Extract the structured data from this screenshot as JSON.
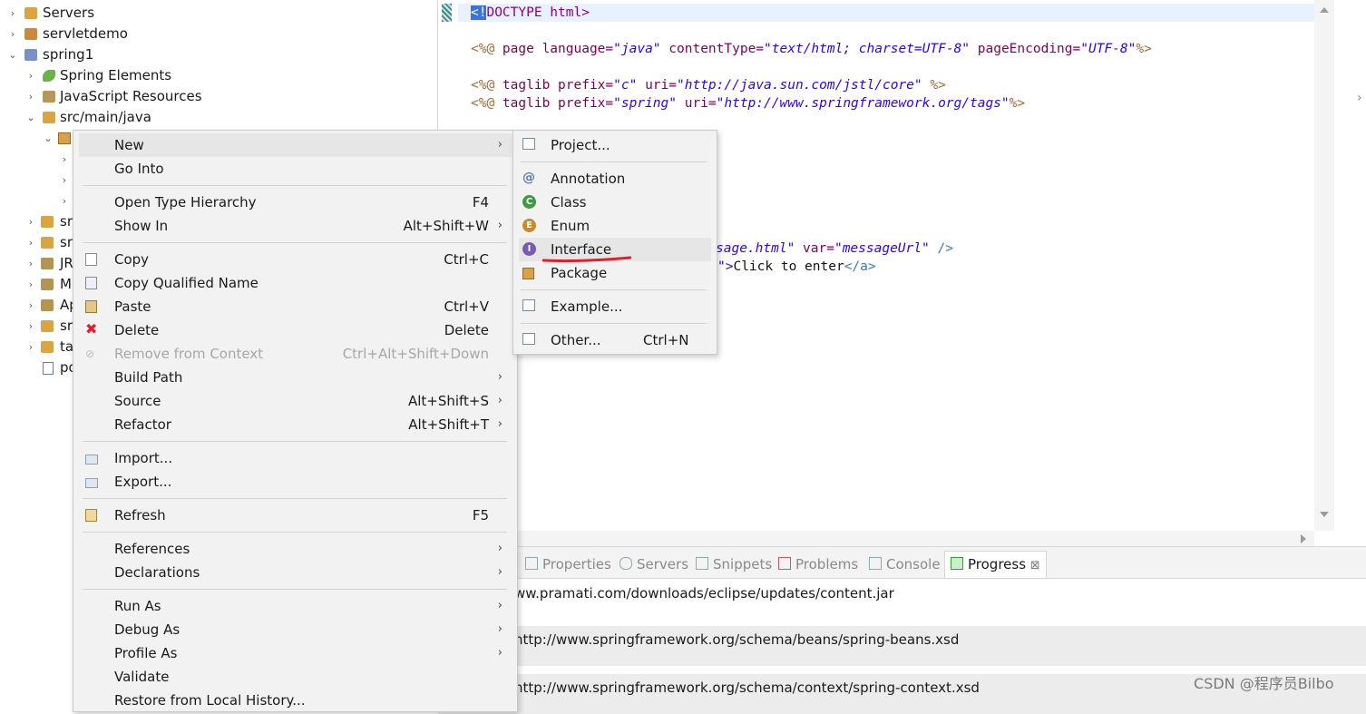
{
  "explorer": {
    "items": [
      {
        "label": "Servers",
        "twisty": "›"
      },
      {
        "label": "servletdemo",
        "twisty": "›"
      },
      {
        "label": "spring1",
        "twisty": "⌄"
      },
      {
        "label": "Spring Elements",
        "twisty": "›"
      },
      {
        "label": "JavaScript Resources",
        "twisty": "›"
      },
      {
        "label": "src/main/java",
        "twisty": "⌄"
      },
      {
        "label": "",
        "twisty": "⌄"
      },
      {
        "label": "",
        "twisty": "›"
      },
      {
        "label": "",
        "twisty": "›"
      },
      {
        "label": "",
        "twisty": "›"
      },
      {
        "label": "sr",
        "twisty": "›"
      },
      {
        "label": "sr",
        "twisty": "›"
      },
      {
        "label": "JR",
        "twisty": "›"
      },
      {
        "label": "M",
        "twisty": "›"
      },
      {
        "label": "Ap",
        "twisty": "›"
      },
      {
        "label": "sr",
        "twisty": "›"
      },
      {
        "label": "ta",
        "twisty": "›"
      },
      {
        "label": "po",
        "twisty": ""
      }
    ]
  },
  "editor": {
    "line1": {
      "lt": "<",
      "excl": "!",
      "rest": "DOCTYPE html>"
    },
    "line2": {
      "a": "<%@ ",
      "b": "page ",
      "c": "language=",
      "d": "\"java\"",
      "e": " contentType=",
      "f": "\"text/html; charset=UTF-8\"",
      "g": " pageEncoding=",
      "h": "\"UTF-8\"",
      "i": "%>"
    },
    "line3": {
      "a": "<%@ ",
      "b": "taglib ",
      "c": "prefix=",
      "d": "\"c\"",
      "e": " uri=",
      "f": "\"http://java.sun.com/jstl/core\"",
      "g": " %>"
    },
    "line4": {
      "a": "<%@ ",
      "b": "taglib ",
      "c": "prefix=",
      "d": "\"spring\"",
      "e": " uri=",
      "f": "\"http://www.springframework.org/tags\"",
      "g": "%>"
    },
    "line5": {
      "a": "sage.html\"",
      "b": " var=",
      "c": "\"messageUrl\"",
      "d": " />"
    },
    "line6": {
      "a": "\">",
      "b": "Click to enter",
      "c": "</a>"
    }
  },
  "context_menu": {
    "items": [
      {
        "label": "New",
        "accel": "",
        "submenu": true
      },
      {
        "label": "Go Into",
        "accel": "",
        "submenu": false
      },
      {
        "label": "Open Type Hierarchy",
        "accel": "F4",
        "submenu": false
      },
      {
        "label": "Show In",
        "accel": "Alt+Shift+W",
        "submenu": true
      },
      {
        "label": "Copy",
        "accel": "Ctrl+C",
        "submenu": false
      },
      {
        "label": "Copy Qualified Name",
        "accel": "",
        "submenu": false
      },
      {
        "label": "Paste",
        "accel": "Ctrl+V",
        "submenu": false
      },
      {
        "label": "Delete",
        "accel": "Delete",
        "submenu": false
      },
      {
        "label": "Remove from Context",
        "accel": "Ctrl+Alt+Shift+Down",
        "submenu": false,
        "disabled": true
      },
      {
        "label": "Build Path",
        "accel": "",
        "submenu": true
      },
      {
        "label": "Source",
        "accel": "Alt+Shift+S",
        "submenu": true
      },
      {
        "label": "Refactor",
        "accel": "Alt+Shift+T",
        "submenu": true
      },
      {
        "label": "Import...",
        "accel": "",
        "submenu": false
      },
      {
        "label": "Export...",
        "accel": "",
        "submenu": false
      },
      {
        "label": "Refresh",
        "accel": "F5",
        "submenu": false
      },
      {
        "label": "References",
        "accel": "",
        "submenu": true
      },
      {
        "label": "Declarations",
        "accel": "",
        "submenu": true
      },
      {
        "label": "Run As",
        "accel": "",
        "submenu": true
      },
      {
        "label": "Debug As",
        "accel": "",
        "submenu": true
      },
      {
        "label": "Profile As",
        "accel": "",
        "submenu": true
      },
      {
        "label": "Validate",
        "accel": "",
        "submenu": false
      },
      {
        "label": "Restore from Local History...",
        "accel": "",
        "submenu": false
      }
    ],
    "arrow": "›"
  },
  "submenu": {
    "items": [
      {
        "label": "Project...",
        "accel": ""
      },
      {
        "label": "Annotation",
        "accel": ""
      },
      {
        "label": "Class",
        "accel": ""
      },
      {
        "label": "Enum",
        "accel": ""
      },
      {
        "label": "Interface",
        "accel": ""
      },
      {
        "label": "Package",
        "accel": ""
      },
      {
        "label": "Example...",
        "accel": ""
      },
      {
        "label": "Other...",
        "accel": "Ctrl+N"
      }
    ]
  },
  "panel": {
    "tabs": [
      {
        "label": "Properties"
      },
      {
        "label": "Servers"
      },
      {
        "label": "Snippets"
      },
      {
        "label": "Problems"
      },
      {
        "label": "Console"
      },
      {
        "label": "Progress",
        "close": "⊠"
      }
    ],
    "rows": [
      "ww.pramati.com/downloads/eclipse/updates/content.jar",
      "http://www.springframework.org/schema/beans/spring-beans.xsd",
      "http://www.springframework.org/schema/context/spring-context.xsd"
    ]
  },
  "watermark": "CSDN @程序员Bilbo",
  "colors": {
    "accent_red": "#e0202a",
    "highlight": "#e6e6e6"
  }
}
